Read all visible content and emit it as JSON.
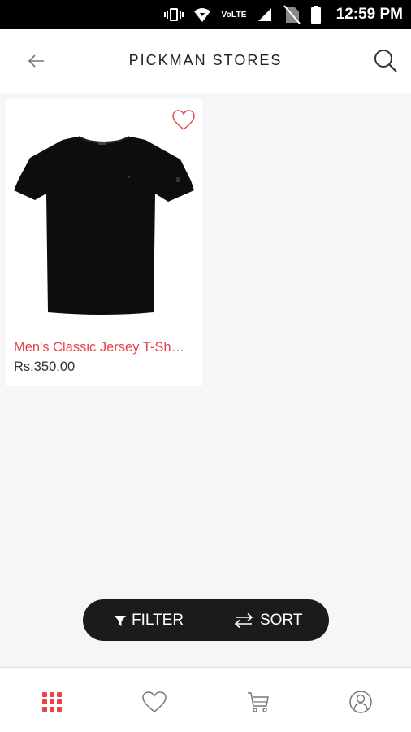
{
  "status_bar": {
    "network_label": "VoLTE",
    "time": "12:59 PM"
  },
  "header": {
    "title": "PICKMAN STORES",
    "back_icon": "arrow-left-icon",
    "search_icon": "search-icon"
  },
  "products": [
    {
      "name": "Men's Classic Jersey T-Sh…",
      "price": "Rs.350.00",
      "image": "black-tshirt",
      "favorite_icon": "heart-outline-icon"
    }
  ],
  "actions": {
    "filter_label": "FILTER",
    "sort_label": "SORT"
  },
  "bottom_nav": [
    {
      "name": "categories",
      "icon": "grid-icon",
      "active": true
    },
    {
      "name": "wishlist",
      "icon": "heart-icon",
      "active": false
    },
    {
      "name": "cart",
      "icon": "cart-icon",
      "active": false
    },
    {
      "name": "account",
      "icon": "user-icon",
      "active": false
    }
  ],
  "colors": {
    "accent": "#e8424a",
    "pill": "#1b1b1b",
    "background": "#f6f6f6"
  }
}
